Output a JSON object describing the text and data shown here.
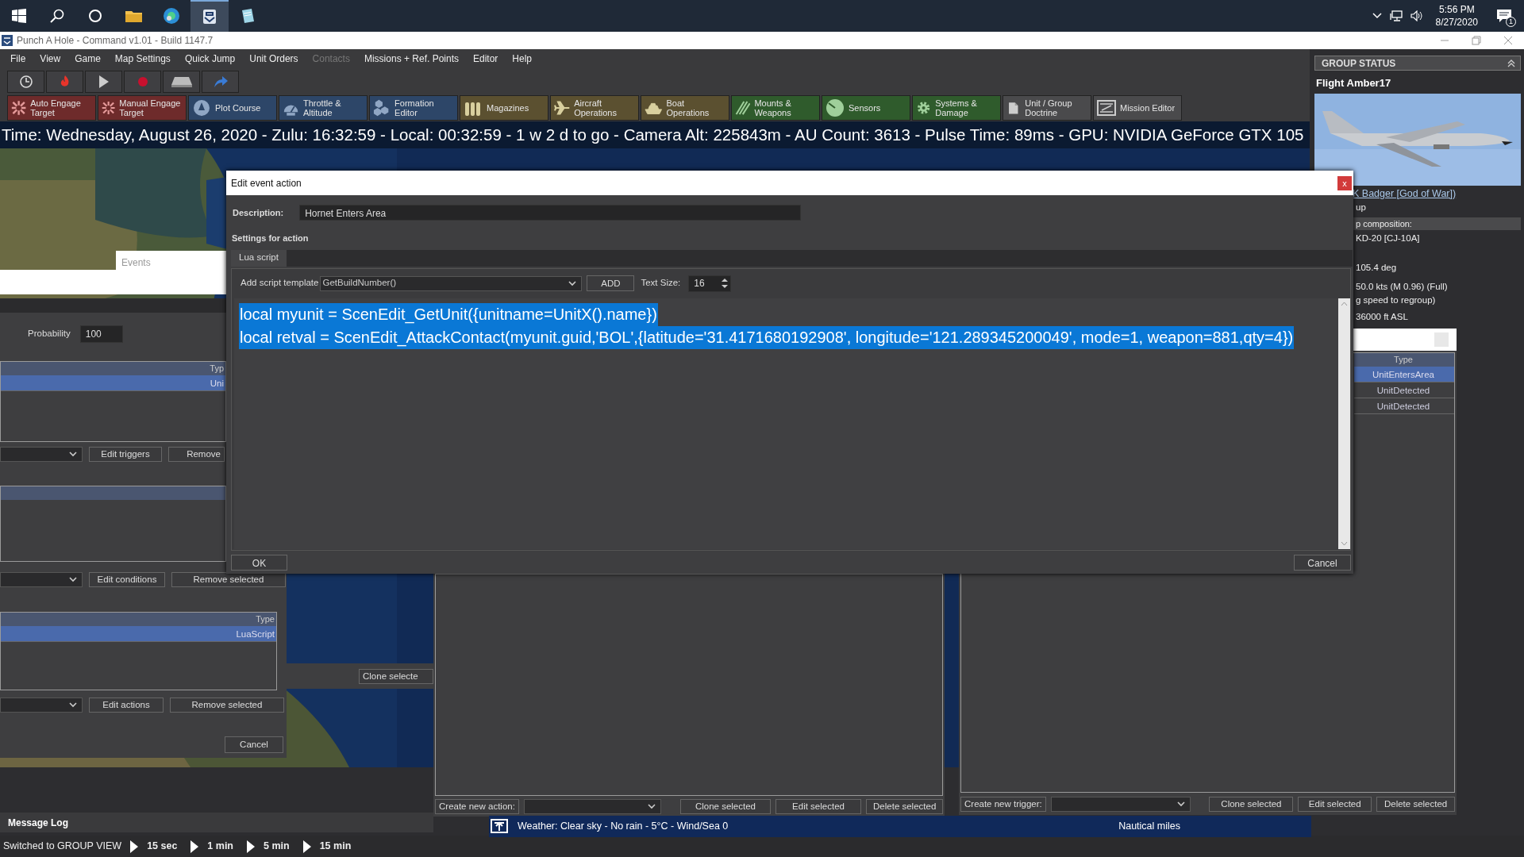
{
  "taskbar": {
    "apps": [
      {
        "selected": false
      },
      {
        "selected": false
      },
      {
        "selected": true
      },
      {
        "selected": false
      }
    ],
    "clock": {
      "time": "5:56 PM",
      "date": "8/27/2020"
    },
    "notifications": "1"
  },
  "window": {
    "title": "Punch A Hole - Command v1.01 - Build 1147.7"
  },
  "menu": [
    {
      "label": "File",
      "disabled": false
    },
    {
      "label": "View",
      "disabled": false
    },
    {
      "label": "Game",
      "disabled": false
    },
    {
      "label": "Map Settings",
      "disabled": false
    },
    {
      "label": "Quick Jump",
      "disabled": false
    },
    {
      "label": "Unit Orders",
      "disabled": false
    },
    {
      "label": "Contacts",
      "disabled": true
    },
    {
      "label": "Missions + Ref. Points",
      "disabled": false
    },
    {
      "label": "Editor",
      "disabled": false
    },
    {
      "label": "Help",
      "disabled": false
    }
  ],
  "command_buttons": [
    {
      "label": "Auto Engage Target",
      "color": "#6e2b2b"
    },
    {
      "label": "Manual Engage Target",
      "color": "#6e2b2b"
    },
    {
      "label": "Plot Course",
      "color": "#2d4668"
    },
    {
      "label": "Throttle & Altitude",
      "color": "#2d4668"
    },
    {
      "label": "Formation Editor",
      "color": "#2d4668"
    },
    {
      "label": "Magazines",
      "color": "#5b5030"
    },
    {
      "label": "Aircraft Operations",
      "color": "#5b5030"
    },
    {
      "label": "Boat Operations",
      "color": "#5b5030"
    },
    {
      "label": "Mounts & Weapons",
      "color": "#2f5b2c"
    },
    {
      "label": "Sensors",
      "color": "#2f5b2c"
    },
    {
      "label": "Systems & Damage",
      "color": "#2f5b2c"
    },
    {
      "label": "Unit / Group Doctrine",
      "color": "#4a4a4c"
    },
    {
      "label": "Mission Editor",
      "color": "#4a4a4c"
    }
  ],
  "status_line": "Time: Wednesday, August 26, 2020 - Zulu: 16:32:59 - Local: 00:32:59 - 1 w 2 d to go -  Camera Alt: 225843m  - AU Count: 3613 - Pulse Time: 89ms - GPU: NVIDIA GeForce GTX 105",
  "group_status": {
    "header": "GROUP STATUS",
    "name": "Flight Amber17",
    "picture": {
      "kind": "picture"
    },
    "link": "K Badger [God of War])",
    "lines": [
      "up"
    ],
    "composition_label": "p composition:",
    "details": [
      "KD-20 [CJ-10A]",
      "105.4 deg",
      "50.0 kts (M 0.96) (Full)",
      "g speed to regroup)",
      "36000 ft ASL"
    ]
  },
  "event_editor": {
    "tab": "Events",
    "probability_label": "Probability",
    "probability": "100",
    "triggers": {
      "column": "Typ",
      "rows": [
        {
          "type": "Uni",
          "selected": true
        }
      ]
    },
    "trigger_buttons": [
      "Edit triggers",
      "Remove"
    ],
    "condition_buttons": [
      "Edit conditions",
      "Remove selected"
    ],
    "actions": {
      "column": "Type",
      "rows": [
        {
          "type": "LuaScript",
          "selected": true
        }
      ]
    },
    "action_buttons": [
      "Edit actions",
      "Remove selected"
    ],
    "cancel": "Cancel"
  },
  "actions_window": {
    "cut_button": "Clone selecte",
    "create_label": "Create new action:",
    "buttons": [
      "Clone selected",
      "Edit selected",
      "Delete selected"
    ]
  },
  "triggers_window": {
    "column": "Type",
    "rows": [
      {
        "type": "UnitEntersArea",
        "selected": true
      },
      {
        "type": "UnitDetected",
        "selected": false
      },
      {
        "type": "UnitDetected",
        "selected": false
      }
    ],
    "create_label": "Create new trigger:",
    "buttons": [
      "Clone selected",
      "Edit selected",
      "Delete selected"
    ]
  },
  "dialog": {
    "title": "Edit event action",
    "close": "x",
    "description_label": "Description:",
    "description": "Hornet Enters Area",
    "settings_label": "Settings for action",
    "tabs": [
      {
        "label": "Lua script",
        "selected": true
      }
    ],
    "template_label": "Add script template",
    "template": "GetBuildNumber()",
    "add": "ADD",
    "text_size_label": "Text Size:",
    "text_size": "16",
    "code": [
      "local myunit = ScenEdit_GetUnit({unitname=UnitX().name})",
      "local retval = ScenEdit_AttackContact(myunit.guid,'BOL',{latitude='31.4171680192908', longitude='121.289345200049', mode=1, weapon=881,qty=4})"
    ],
    "code_selected": true,
    "ok": "OK",
    "cancel": "Cancel"
  },
  "weather": "Weather: Clear sky - No rain - 5°C - Wind/Sea 0",
  "scale_label": "Nautical miles",
  "message_log": "Message Log",
  "footer": {
    "message": "Switched to GROUP VIEW",
    "speeds": [
      "15 sec",
      "1 min",
      "5 min",
      "15 min"
    ]
  }
}
